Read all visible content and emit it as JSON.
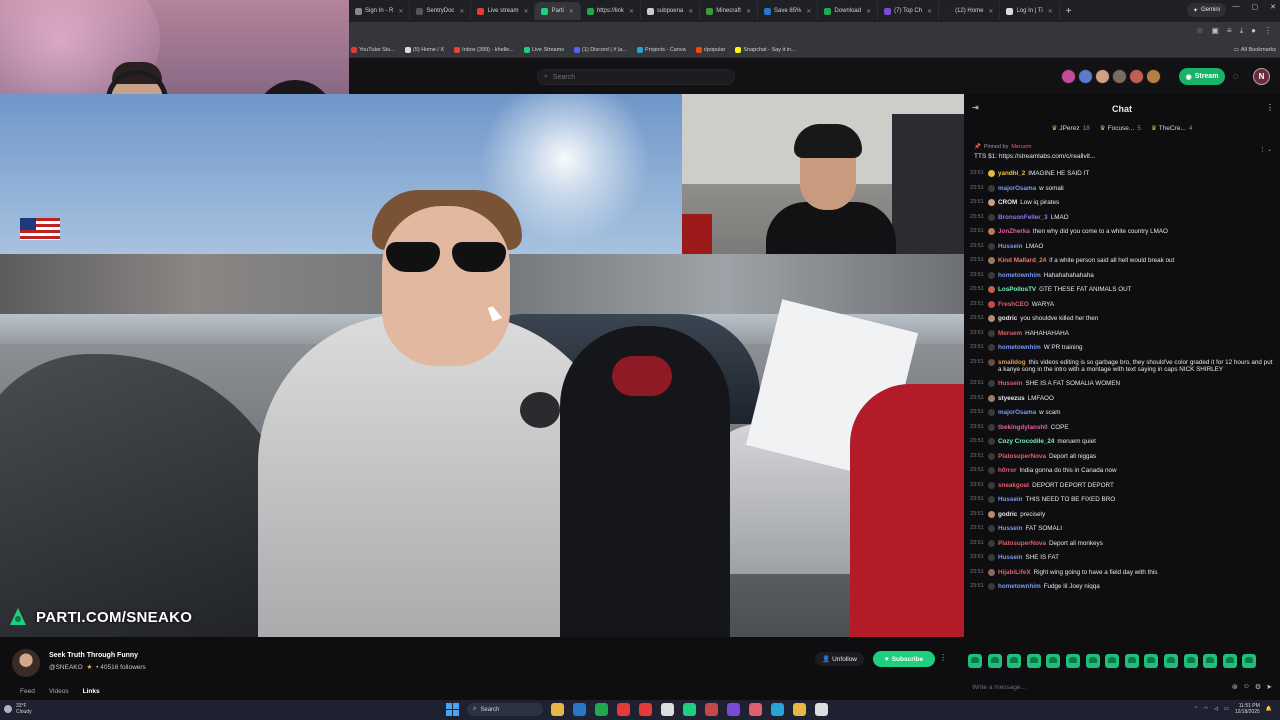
{
  "browser": {
    "tabs": [
      {
        "label": "Sign In - R",
        "color": "#888888"
      },
      {
        "label": "SentryDoc",
        "color": "#555555"
      },
      {
        "label": "Live stream",
        "color": "#e33a3a"
      },
      {
        "label": "Parti",
        "color": "#1fcf7f",
        "active": true
      },
      {
        "label": "https://link",
        "color": "#1fa84f"
      },
      {
        "label": "subpoena",
        "color": "#cccccc"
      },
      {
        "label": "Minecraft",
        "color": "#3a9a3a"
      },
      {
        "label": "Save 85%",
        "color": "#2a76c8"
      },
      {
        "label": "Download",
        "color": "#1fa84f"
      },
      {
        "label": "(7) Top Ch",
        "color": "#7a4ad8"
      },
      {
        "label": "(12) Home",
        "color": "#222222"
      },
      {
        "label": "Log In | Ti",
        "color": "#dddddd"
      }
    ],
    "gemini_label": "Gemini",
    "bookmarks": [
      {
        "label": "YouTube Stu...",
        "color": "#e33a3a"
      },
      {
        "label": "(5) Home / X",
        "color": "#dddddd"
      },
      {
        "label": "Inbox (399) - khelle...",
        "color": "#e0473a"
      },
      {
        "label": "Live Streams",
        "color": "#1fcf7f"
      },
      {
        "label": "(1) Discord | #  |a...",
        "color": "#5865f2"
      },
      {
        "label": "Projects - Canva",
        "color": "#2aa2d8"
      },
      {
        "label": "r/popular",
        "color": "#ff4500"
      },
      {
        "label": "Snapchat - Say it in...",
        "color": "#fffc00"
      }
    ],
    "all_bookmarks": "All Bookmarks"
  },
  "header": {
    "search_placeholder": "Search",
    "stream_label": "Stream",
    "avatar_colors": [
      "#c44a9a",
      "#5a7ad0",
      "#d0a080",
      "#7a6a60",
      "#c06050",
      "#b88040"
    ],
    "me_initial": "N"
  },
  "video": {
    "brand_text": "PARTI.COM/SNEAKO"
  },
  "profile": {
    "tagline": "Seek Truth Through Funny",
    "handle": "@SNEAKO",
    "followers": "40516",
    "followers_label": "followers",
    "unfollow_label": "Unfollow",
    "subscribe_label": "Subscribe",
    "tabs": [
      {
        "label": "Feed",
        "active": false
      },
      {
        "label": "Videos",
        "active": false
      },
      {
        "label": "Links",
        "active": true
      }
    ]
  },
  "chat": {
    "title": "Chat",
    "top_chatters": [
      {
        "name": "JPerez",
        "count": "18"
      },
      {
        "name": "Focuse...",
        "count": "5"
      },
      {
        "name": "TheCre...",
        "count": "4"
      }
    ],
    "pinned_by_label": "Pinned by",
    "pinned_by_user": "Meruem",
    "pinned_message": "TTS $1: https://streamlabs.com/c/reallvit...",
    "messages": [
      {
        "time": "23:51",
        "user": "yandhi_2",
        "color": "#f0c14a",
        "badge": "#e8b54a",
        "text": "IMAGINE HE SAID IT"
      },
      {
        "time": "23:51",
        "user": "majorOsama",
        "color": "#7a9af0",
        "badge": "#3a3a3a",
        "text": "w somali"
      },
      {
        "time": "23:51",
        "user": "CROM",
        "color": "#e8e8ea",
        "badge": "#c9a07a",
        "text": "Low iq pirates"
      },
      {
        "time": "23:51",
        "user": "BronsonFeller_3",
        "color": "#8a7af0",
        "badge": "#3a3a3a",
        "text": "LMAO"
      },
      {
        "time": "23:51",
        "user": "JonZherka",
        "color": "#e05f9f",
        "badge": "#b87a5a",
        "text": "then why did you come to a white country LMAO"
      },
      {
        "time": "23:51",
        "user": "Hussein",
        "color": "#7a9af0",
        "badge": "#3a3a3a",
        "text": "LMAO"
      },
      {
        "time": "23:51",
        "user": "Kind Mallard_24",
        "color": "#f07a5f",
        "badge": "#9a7a5a",
        "text": "if a white person said all hell would break out"
      },
      {
        "time": "23:51",
        "user": "hometownhim",
        "color": "#7a9af0",
        "badge": "#3a3a3a",
        "text": "Hahahahahahaha"
      },
      {
        "time": "23:51",
        "user": "LosPollosTV",
        "color": "#7af0c0",
        "badge": "#c06050",
        "text": "GTE THESE FAT ANIMALS OUT"
      },
      {
        "time": "23:51",
        "user": "FreshCEO",
        "color": "#e05f6f",
        "badge": "#c44a4a",
        "text": "WARYA"
      },
      {
        "time": "23:51",
        "user": "godric",
        "color": "#e8e8ea",
        "badge": "#b88a6a",
        "text": "you shouldve killed her then"
      },
      {
        "time": "23:51",
        "user": "Meruem",
        "color": "#e05f6f",
        "badge": "#3a3a3a",
        "text": "HAHAHAHAHA"
      },
      {
        "time": "23:51",
        "user": "hometownhim",
        "color": "#7a9af0",
        "badge": "#3a3a3a",
        "text": "W PR training"
      },
      {
        "time": "23:51",
        "user": "smalldog",
        "color": "#e0a04a",
        "badge": "#6a4a3a",
        "text": "this videos editing is so garbage bro, they should've color graded it for 12 hours and put a kanye song in the intro with a montage with text saying in caps NICK SHIRLEY"
      },
      {
        "time": "23:51",
        "user": "Hussein",
        "color": "#e05f6f",
        "badge": "#3a3a3a",
        "text": "SHE IS A FAT SOMALIA WOMEN"
      },
      {
        "time": "23:51",
        "user": "styeezus",
        "color": "#e8e8ea",
        "badge": "#a07a60",
        "text": "LMFAOO"
      },
      {
        "time": "23:51",
        "user": "majorOsama",
        "color": "#7a9af0",
        "badge": "#3a3a3a",
        "text": "w scam"
      },
      {
        "time": "23:51",
        "user": "tbekingdylansh0",
        "color": "#e05f9f",
        "badge": "#3a3a3a",
        "text": "COPE"
      },
      {
        "time": "23:51",
        "user": "Cozy Crocodile_24",
        "color": "#7af0c0",
        "badge": "#3a3a3a",
        "text": "meruem quiet"
      },
      {
        "time": "23:51",
        "user": "PlatosuperNova",
        "color": "#e05f6f",
        "badge": "#3a3a3a",
        "text": "Deport all niggas"
      },
      {
        "time": "23:51",
        "user": "h0rror",
        "color": "#e05f6f",
        "badge": "#3a3a3a",
        "text": "India gonna do this in Canada now"
      },
      {
        "time": "23:51",
        "user": "sneakgoat",
        "color": "#e05f6f",
        "badge": "#3a3a3a",
        "text": "DEPORT DEPORT DEPORT"
      },
      {
        "time": "23:51",
        "user": "Hussein",
        "color": "#7a9af0",
        "badge": "#3a3a3a",
        "text": "THIS NEED TO BE FIXED BRO"
      },
      {
        "time": "23:51",
        "user": "godric",
        "color": "#e8e8ea",
        "badge": "#b88a6a",
        "text": "precisely"
      },
      {
        "time": "23:51",
        "user": "Hussein",
        "color": "#7a9af0",
        "badge": "#3a3a3a",
        "text": "FAT SOMALI"
      },
      {
        "time": "23:51",
        "user": "PlatosuperNova",
        "color": "#e05f6f",
        "badge": "#3a3a3a",
        "text": "Deport all monkeys"
      },
      {
        "time": "23:51",
        "user": "Hussein",
        "color": "#7a9af0",
        "badge": "#3a3a3a",
        "text": "SHE IS FAT"
      },
      {
        "time": "23:51",
        "user": "HijabiLifeX",
        "color": "#e05f6f",
        "badge": "#8a6a5a",
        "text": "Right wing going to have a field day with this"
      },
      {
        "time": "23:51",
        "user": "hometownhim",
        "color": "#7a9af0",
        "badge": "#3a3a3a",
        "text": "Fudge lil Joey niqqa"
      }
    ],
    "input_placeholder": "Write a message..."
  },
  "taskbar": {
    "weather_temp": "33°F",
    "weather_desc": "Cloudy",
    "search_label": "Search",
    "time": "11:51 PM",
    "date": "12/18/2025",
    "app_colors": [
      "#e8b54a",
      "#2a76c8",
      "#1fa84f",
      "#e33a3a",
      "#e33a3a",
      "#dddddd",
      "#1fcf7f",
      "#c44a4a",
      "#7a4ad8",
      "#e05f6f",
      "#2aa2d8",
      "#e8b54a",
      "#dddddd"
    ]
  }
}
